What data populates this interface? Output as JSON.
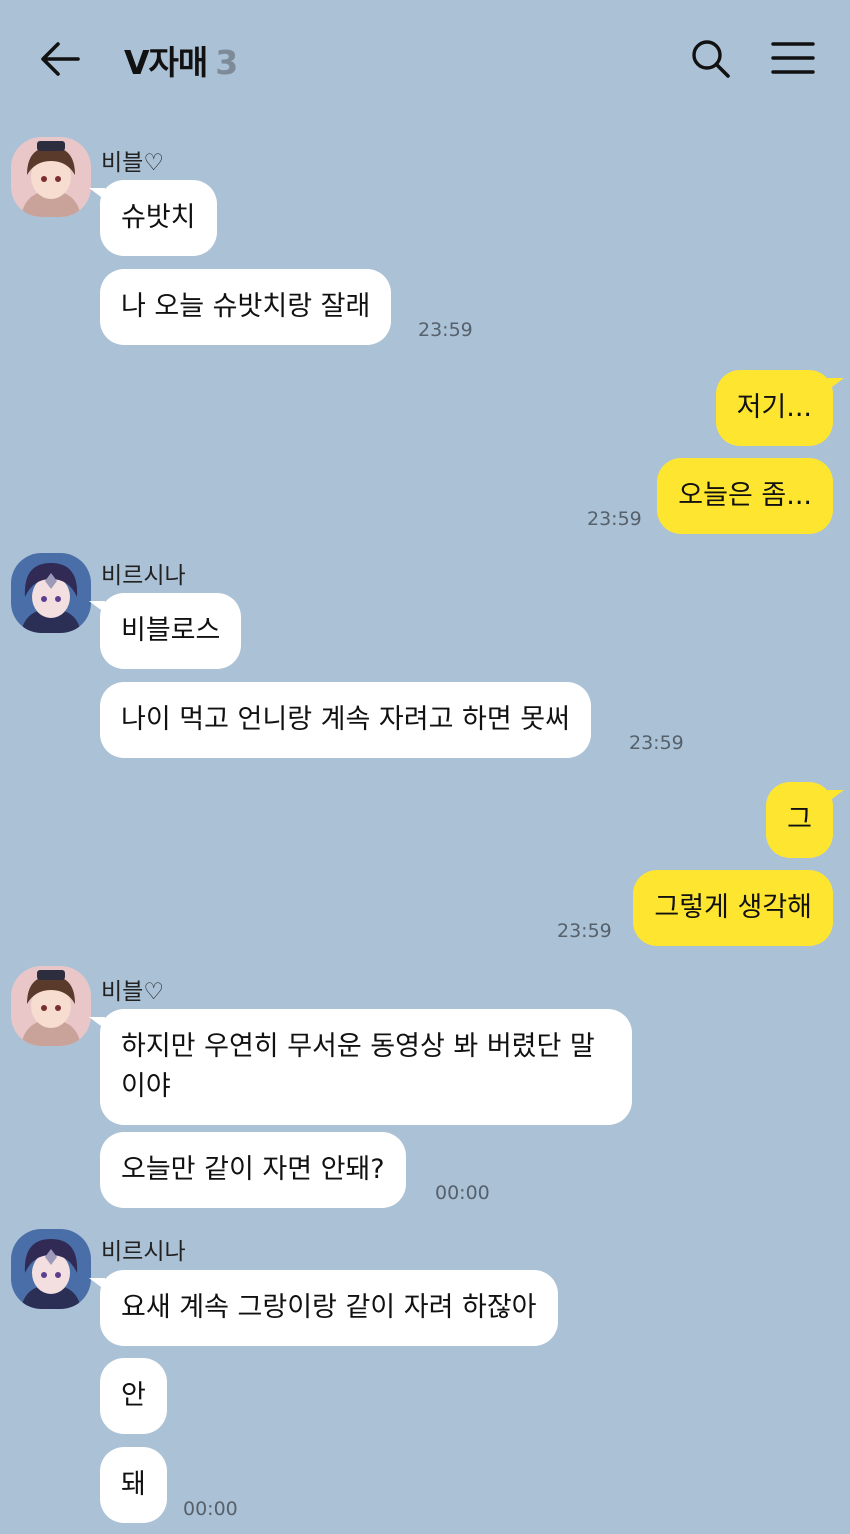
{
  "header": {
    "title": "V자매",
    "member_count": "3"
  },
  "messages": [
    {
      "sender": "비블♡",
      "text": "슈밧치"
    },
    {
      "sender": "비블♡",
      "text": "나 오늘 슈밧치랑 잘래",
      "time": "23:59"
    },
    {
      "sender": "me",
      "text": "저기..."
    },
    {
      "sender": "me",
      "text": "오늘은 좀...",
      "time": "23:59"
    },
    {
      "sender": "비르시나",
      "text": "비블로스"
    },
    {
      "sender": "비르시나",
      "text": "나이 먹고 언니랑 계속 자려고 하면 못써",
      "time": "23:59"
    },
    {
      "sender": "me",
      "text": "그"
    },
    {
      "sender": "me",
      "text": "그렇게 생각해",
      "time": "23:59"
    },
    {
      "sender": "비블♡",
      "text": "하지만 우연히 무서운 동영상 봐 버렸단 말이야"
    },
    {
      "sender": "비블♡",
      "text": "오늘만 같이 자면 안돼?",
      "time": "00:00"
    },
    {
      "sender": "비르시나",
      "text": "요새 계속 그랑이랑 같이 자려 하잖아"
    },
    {
      "sender": "비르시나",
      "text": "안"
    },
    {
      "sender": "비르시나",
      "text": "돼",
      "time": "00:00"
    }
  ],
  "colors": {
    "background": "#abc1d6",
    "incoming_bubble": "#ffffff",
    "outgoing_bubble": "#fee630"
  },
  "icons": {
    "back": "arrow-left-icon",
    "search": "search-icon",
    "menu": "hamburger-menu-icon"
  }
}
